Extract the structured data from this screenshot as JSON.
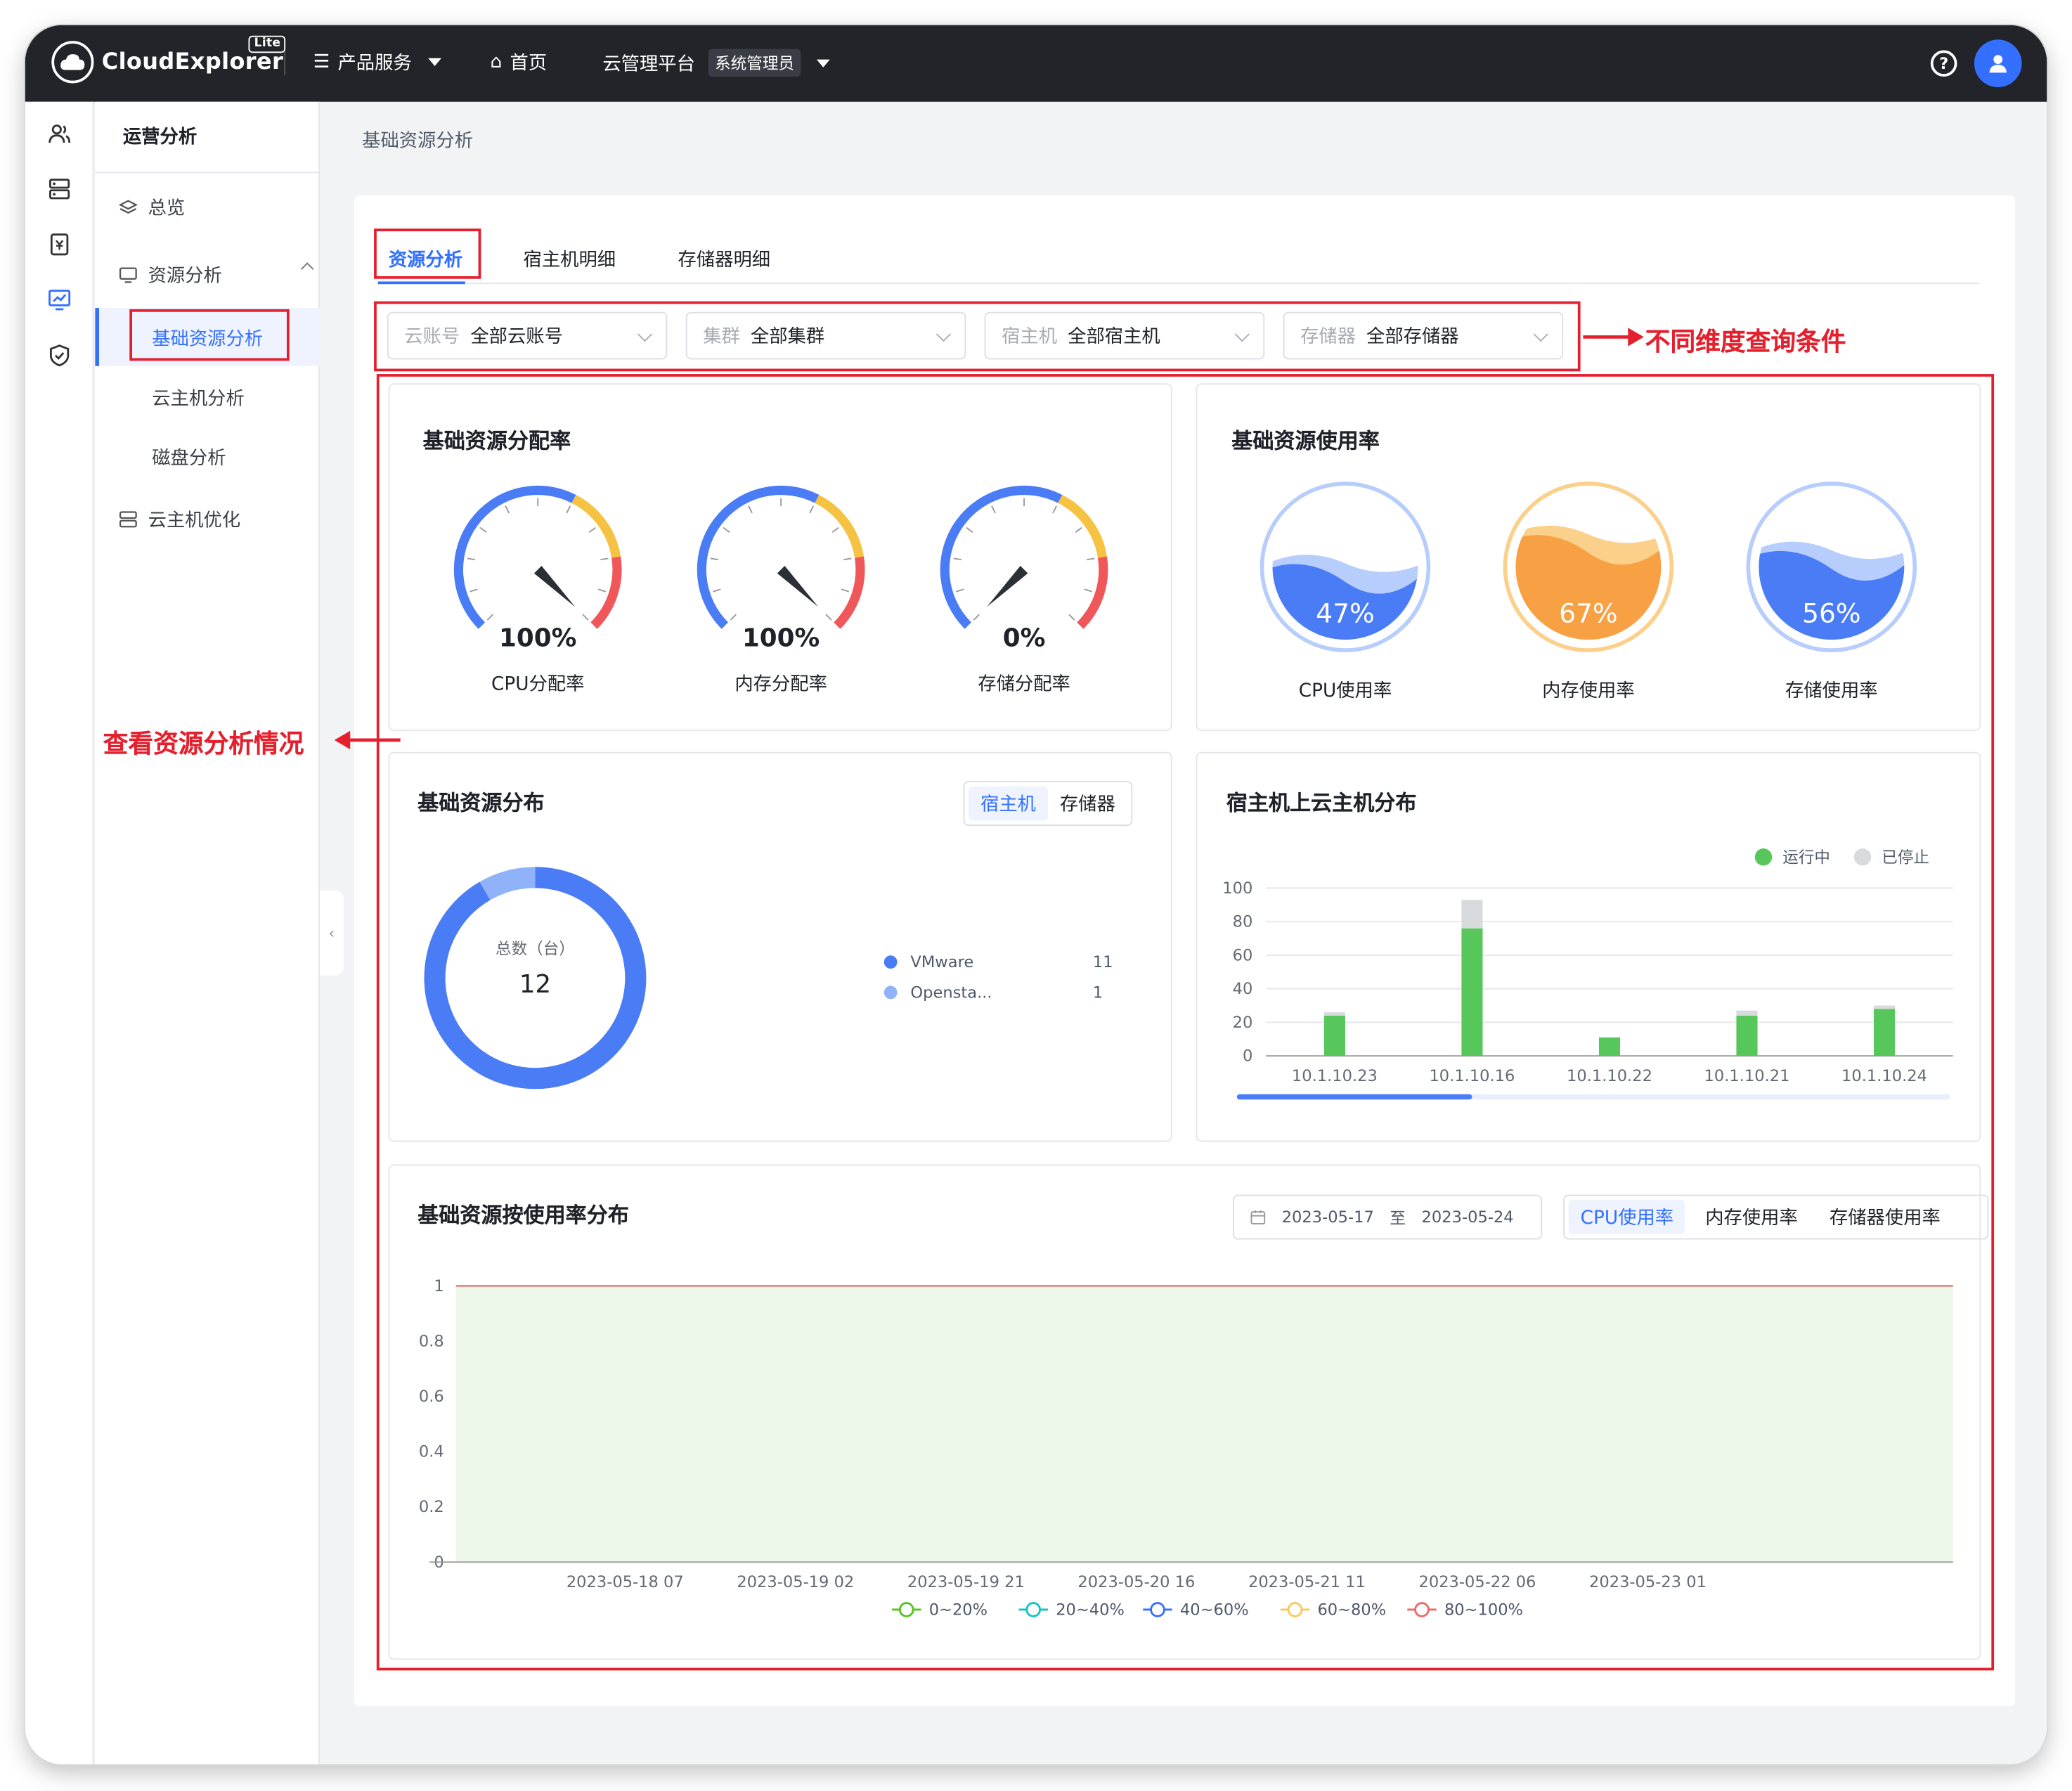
{
  "topbar": {
    "brand": "CloudExplorer",
    "brand_badge": "Lite",
    "products_menu": "产品服务",
    "home": "首页",
    "platform": "云管理平台",
    "role": "系统管理员"
  },
  "sidebar": {
    "title": "运营分析",
    "items": [
      {
        "label": "总览"
      },
      {
        "label": "资源分析"
      },
      {
        "label": "基础资源分析"
      },
      {
        "label": "云主机分析"
      },
      {
        "label": "磁盘分析"
      },
      {
        "label": "云主机优化"
      }
    ]
  },
  "breadcrumb": "基础资源分析",
  "tabs": [
    "资源分析",
    "宿主机明细",
    "存储器明细"
  ],
  "filters": [
    {
      "label": "云账号",
      "value": "全部云账号"
    },
    {
      "label": "集群",
      "value": "全部集群"
    },
    {
      "label": "宿主机",
      "value": "全部宿主机"
    },
    {
      "label": "存储器",
      "value": "全部存储器"
    }
  ],
  "annotations": {
    "filters_note": "不同维度查询条件",
    "analysis_note": "查看资源分析情况"
  },
  "allocation": {
    "title": "基础资源分配率",
    "gauges": [
      {
        "label": "CPU分配率",
        "value": "100%",
        "percent": 100
      },
      {
        "label": "内存分配率",
        "value": "100%",
        "percent": 100
      },
      {
        "label": "存储分配率",
        "value": "0%",
        "percent": 0
      }
    ]
  },
  "usage": {
    "title": "基础资源使用率",
    "meters": [
      {
        "label": "CPU使用率",
        "value": "47%",
        "percent": 47,
        "color": "#4a7cf6"
      },
      {
        "label": "内存使用率",
        "value": "67%",
        "percent": 67,
        "color": "#f7a044"
      },
      {
        "label": "存储使用率",
        "value": "56%",
        "percent": 56,
        "color": "#4a7cf6"
      }
    ]
  },
  "distribution": {
    "title": "基础资源分布",
    "toggle": [
      "宿主机",
      "存储器"
    ],
    "total_label": "总数（台）",
    "total": "12",
    "legend": [
      {
        "name": "VMware",
        "count": "11",
        "color": "#4a7cf6"
      },
      {
        "name": "Opensta...",
        "count": "1",
        "color": "#8fb2f9"
      }
    ]
  },
  "host_vms": {
    "title": "宿主机上云主机分布",
    "legend": [
      {
        "name": "运行中",
        "color": "#57c75b"
      },
      {
        "name": "已停止",
        "color": "#d9dadd"
      }
    ]
  },
  "usage_distribution": {
    "title": "基础资源按使用率分布",
    "date_from": "2023-05-17",
    "date_sep": "至",
    "date_to": "2023-05-24",
    "toggle": [
      "CPU使用率",
      "内存使用率",
      "存储器使用率"
    ]
  },
  "chart_data": [
    {
      "type": "bar",
      "title": "宿主机上云主机分布",
      "categories": [
        "10.1.10.23",
        "10.1.10.16",
        "10.1.10.22",
        "10.1.10.21",
        "10.1.10.24"
      ],
      "series": [
        {
          "name": "运行中",
          "values": [
            24,
            76,
            11,
            24,
            28
          ],
          "color": "#57c75b"
        },
        {
          "name": "已停止",
          "values": [
            2,
            17,
            0,
            3,
            2
          ],
          "color": "#d9dadd"
        }
      ],
      "yticks": [
        "0",
        "20",
        "40",
        "60",
        "80",
        "100"
      ],
      "ylim": [
        0,
        100
      ],
      "stacked": true,
      "legend": "top-right",
      "grid": true
    },
    {
      "type": "area",
      "title": "基础资源按使用率分布",
      "x": [
        "2023-05-18 07",
        "2023-05-19 02",
        "2023-05-19 21",
        "2023-05-20 16",
        "2023-05-21 11",
        "2023-05-22 06",
        "2023-05-23 01"
      ],
      "yticks": [
        "0",
        "0.2",
        "0.4",
        "0.6",
        "0.8",
        "1"
      ],
      "ylim": [
        0,
        1
      ],
      "series": [
        {
          "name": "0~20%",
          "value": 1,
          "color": "#52c41a"
        },
        {
          "name": "20~40%",
          "value": 0,
          "color": "#13c2c2"
        },
        {
          "name": "40~60%",
          "value": 0,
          "color": "#3370ff"
        },
        {
          "name": "60~80%",
          "value": 0,
          "color": "#fac858"
        },
        {
          "name": "80~100%",
          "value": 0,
          "color": "#ee6666"
        }
      ],
      "legend": "bottom"
    }
  ]
}
